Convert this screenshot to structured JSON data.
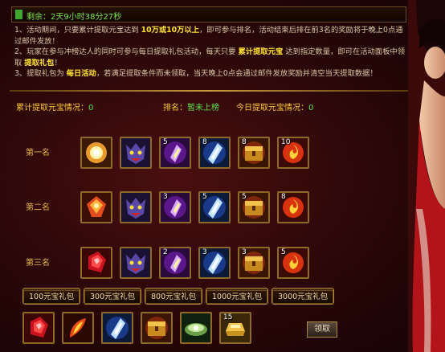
{
  "timer": "剩余：2天9小时38分27秒",
  "rules": [
    [
      "1、活动期间，只要累计提取元宝达到 ",
      {
        "hl": "10万或10万以上"
      },
      "，即可参与排名，活动结束后排在前3名的奖励将于晚上0点通过邮件发放！"
    ],
    [
      "2、玩家在参与冲榜达人的同时可参与每日提取礼包活动，每天只要 ",
      {
        "hl": "累计提取元宝"
      },
      " 达到指定数量，即可在活动面板中领取 ",
      {
        "hl": "提取礼包"
      },
      "！"
    ],
    [
      "3、提取礼包为 ",
      {
        "hl": "每日活动"
      },
      "，若满足提取条件而未领取，当天晚上0点会通过邮件发放奖励并清空当天提取数据！"
    ]
  ],
  "stats": {
    "total_label": "累计提取元宝情况：",
    "total_value": "0",
    "rank_label": "排名：",
    "rank_value": "暂未上榜",
    "today_label": "今日提取元宝情况：",
    "today_value": "0"
  },
  "ranks": [
    {
      "label": "第一名",
      "items": [
        {
          "icon": "golden-orb-icon",
          "count": ""
        },
        {
          "icon": "demon-mask-icon",
          "count": ""
        },
        {
          "icon": "purple-crystal-icon",
          "count": "5"
        },
        {
          "icon": "blue-crystal-icon",
          "count": "8"
        },
        {
          "icon": "treasure-chest-icon",
          "count": "8"
        },
        {
          "icon": "fire-orb-icon",
          "count": "10"
        }
      ]
    },
    {
      "label": "第二名",
      "items": [
        {
          "icon": "red-gem-icon",
          "count": ""
        },
        {
          "icon": "demon-mask-icon",
          "count": ""
        },
        {
          "icon": "purple-crystal-icon",
          "count": "3"
        },
        {
          "icon": "blue-crystal-icon",
          "count": "5"
        },
        {
          "icon": "treasure-chest-icon",
          "count": "5"
        },
        {
          "icon": "fire-orb-icon",
          "count": "8"
        }
      ]
    },
    {
      "label": "第三名",
      "items": [
        {
          "icon": "ruby-shard-icon",
          "count": ""
        },
        {
          "icon": "demon-mask-icon",
          "count": ""
        },
        {
          "icon": "purple-crystal-icon",
          "count": "2"
        },
        {
          "icon": "blue-crystal-icon",
          "count": "3"
        },
        {
          "icon": "treasure-chest-icon",
          "count": "3"
        },
        {
          "icon": "fire-orb-icon",
          "count": "5"
        }
      ]
    }
  ],
  "packs": [
    "100元宝礼包",
    "300元宝礼包",
    "800元宝礼包",
    "1000元宝礼包",
    "3000元宝礼包"
  ],
  "bottom_items": [
    {
      "icon": "ruby-shard-icon",
      "count": ""
    },
    {
      "icon": "fire-feather-icon",
      "count": ""
    },
    {
      "icon": "blue-crystal-icon",
      "count": ""
    },
    {
      "icon": "treasure-chest-icon",
      "count": ""
    },
    {
      "icon": "jade-plate-icon",
      "count": ""
    },
    {
      "icon": "gold-ingot-icon",
      "count": "15"
    }
  ],
  "claim_label": "领取",
  "colors": {
    "accent": "#ffe330",
    "green": "#5de04a",
    "label": "#e9b94a"
  }
}
